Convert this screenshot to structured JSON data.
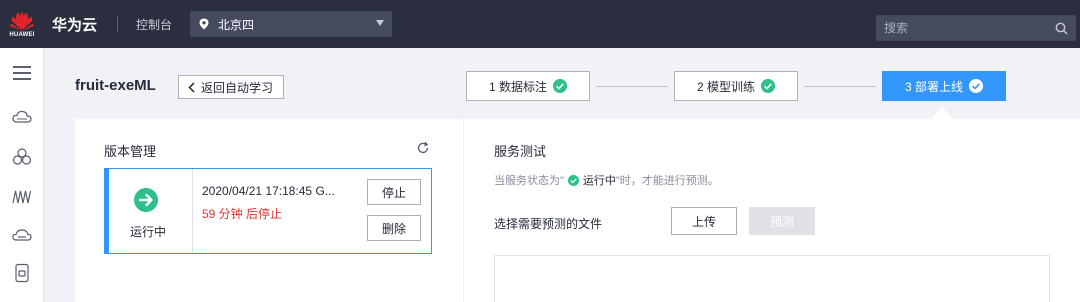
{
  "topbar": {
    "brand": "HUAWEI",
    "cloud_name": "华为云",
    "console": "控制台",
    "region": "北京四",
    "search_placeholder": "搜索"
  },
  "rail": {
    "icons": [
      "menu-icon",
      "cloud-service-icon",
      "cluster-icon",
      "model-icon",
      "storage-icon",
      "document-icon"
    ]
  },
  "header": {
    "title": "fruit-exeML",
    "back_label": "返回自动学习"
  },
  "steps": [
    {
      "label": "1 数据标注",
      "done": true
    },
    {
      "label": "2 模型训练",
      "done": true
    },
    {
      "label": "3 部署上线",
      "active": true
    }
  ],
  "version_panel": {
    "title": "版本管理",
    "card": {
      "status": "运行中",
      "timestamp": "2020/04/21 17:18:45 G...",
      "stop_info": "59 分钟 后停止",
      "stop_button": "停止",
      "delete_button": "删除"
    }
  },
  "service_test": {
    "title": "服务测试",
    "hint_prefix": "当服务状态为\"",
    "hint_status": "运行中",
    "hint_suffix": "\"时，才能进行预测。",
    "file_label": "选择需要预测的文件",
    "upload_button": "上传",
    "predict_button": "预测"
  },
  "colors": {
    "topbar_bg": "#2a2e3f",
    "accent": "#3296fa",
    "success": "#2ebf8a",
    "danger": "#e0372f"
  }
}
